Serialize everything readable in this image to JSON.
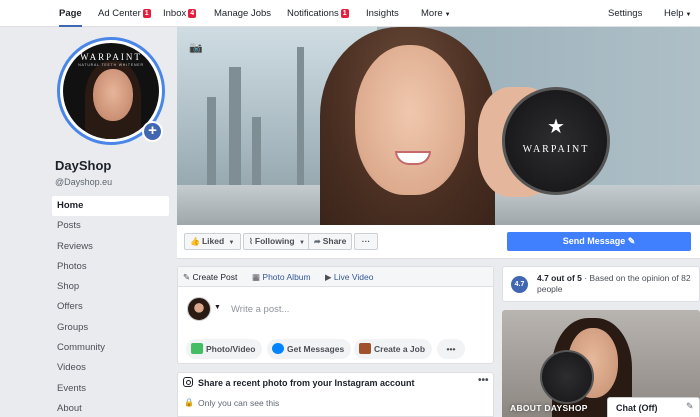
{
  "topnav": {
    "items": [
      {
        "label": "Page",
        "badge": ""
      },
      {
        "label": "Ad Center",
        "badge": "1"
      },
      {
        "label": "Inbox",
        "badge": "4"
      },
      {
        "label": "Manage Jobs",
        "badge": ""
      },
      {
        "label": "Notifications",
        "badge": "1"
      },
      {
        "label": "Insights",
        "badge": ""
      },
      {
        "label": "More",
        "badge": ""
      }
    ],
    "settings_label": "Settings",
    "help_label": "Help"
  },
  "profile": {
    "name": "DayShop",
    "handle": "@Dayshop.eu",
    "avatar_brand": "WARPAINT",
    "avatar_sub": "NATURAL TEETH WHITENER"
  },
  "sidebar": {
    "items": [
      {
        "label": "Home"
      },
      {
        "label": "Posts"
      },
      {
        "label": "Reviews"
      },
      {
        "label": "Photos"
      },
      {
        "label": "Shop"
      },
      {
        "label": "Offers"
      },
      {
        "label": "Groups"
      },
      {
        "label": "Community"
      },
      {
        "label": "Videos"
      },
      {
        "label": "Events"
      },
      {
        "label": "About"
      }
    ]
  },
  "cover": {
    "jar_brand": "WARPAINT"
  },
  "actions": {
    "liked_label": "Liked",
    "following_label": "Following",
    "share_label": "Share",
    "more_label": "···",
    "send_message_label": "Send Message"
  },
  "composer": {
    "tabs": [
      {
        "label": "Create Post"
      },
      {
        "label": "Photo Album"
      },
      {
        "label": "Live Video"
      }
    ],
    "placeholder": "Write a post...",
    "pills": [
      {
        "label": "Photo/Video"
      },
      {
        "label": "Get Messages"
      },
      {
        "label": "Create a Job"
      }
    ],
    "more_label": "•••"
  },
  "instagram": {
    "title": "Share a recent photo from your Instagram account",
    "subtitle": "Only you can see this",
    "more_label": "•••"
  },
  "rating": {
    "badge": "4.7",
    "score_text": "4.7 out of 5",
    "detail_text": " · Based on the opinion of 82 people"
  },
  "about": {
    "label": "ABOUT DAYSHOP"
  },
  "chat": {
    "label": "Chat (Off)"
  },
  "colors": {
    "brand_blue": "#4267b2",
    "send_button": "#4080ff",
    "badge_red": "#e41e3f",
    "background": "#e9ebee"
  }
}
